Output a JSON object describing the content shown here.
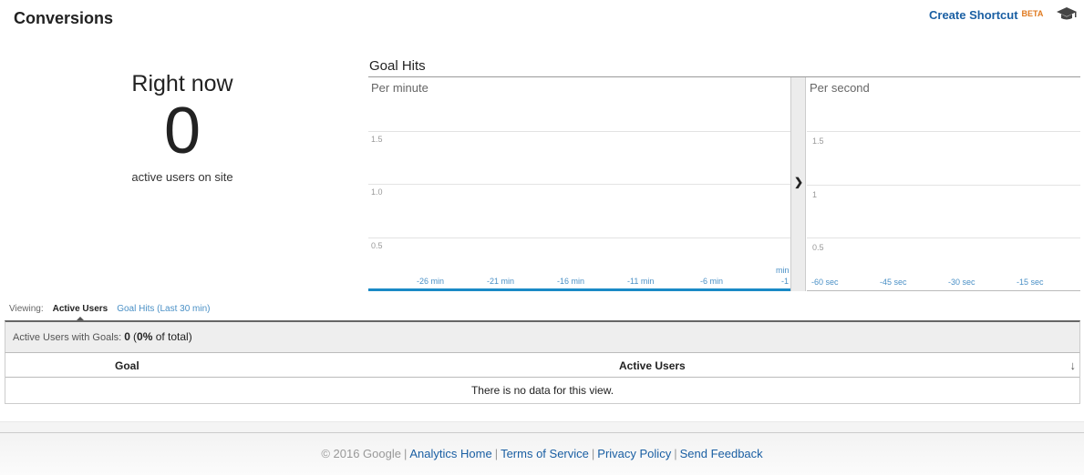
{
  "header": {
    "title": "Conversions",
    "create_shortcut": "Create Shortcut",
    "beta_badge": "BETA",
    "help_icon": "graduation-cap-icon"
  },
  "right_now": {
    "label": "Right now",
    "value": "0",
    "sublabel": "active users on site"
  },
  "goal_hits": {
    "title": "Goal Hits",
    "per_minute": {
      "label": "Per minute",
      "y_ticks": [
        "1.5",
        "1.0",
        "0.5"
      ],
      "x_ticks": [
        "-26 min",
        "-21 min",
        "-16 min",
        "-11 min",
        "-6 min"
      ],
      "last_tick_top": "min",
      "last_tick_bottom": "-1"
    },
    "per_second": {
      "label": "Per second",
      "y_ticks": [
        "1.5",
        "1",
        "0.5"
      ],
      "x_ticks": [
        "-60 sec",
        "-45 sec",
        "-30 sec",
        "-15 sec"
      ]
    },
    "expand_icon": "chevron-right-icon"
  },
  "chart_data": [
    {
      "type": "bar",
      "title": "Goal Hits - Per minute",
      "xlabel": "",
      "ylabel": "",
      "categories": [
        "-26 min",
        "-21 min",
        "-16 min",
        "-11 min",
        "-6 min",
        "-1 min"
      ],
      "values": [
        0,
        0,
        0,
        0,
        0,
        0
      ],
      "ylim": [
        0,
        2
      ],
      "y_ticks": [
        0.5,
        1.0,
        1.5
      ],
      "grid": true
    },
    {
      "type": "bar",
      "title": "Goal Hits - Per second",
      "xlabel": "",
      "ylabel": "",
      "categories": [
        "-60 sec",
        "-45 sec",
        "-30 sec",
        "-15 sec"
      ],
      "values": [
        0,
        0,
        0,
        0
      ],
      "ylim": [
        0,
        2
      ],
      "y_ticks": [
        0.5,
        1,
        1.5
      ],
      "grid": true
    }
  ],
  "viewing": {
    "label": "Viewing:",
    "tabs": [
      {
        "label": "Active Users",
        "active": true
      },
      {
        "label": "Goal Hits (Last 30 min)",
        "active": false
      }
    ]
  },
  "summary": {
    "label": "Active Users with Goals:",
    "value": "0",
    "pct_open": "(",
    "pct": "0%",
    "pct_rest": " of total)"
  },
  "table": {
    "columns": [
      "Goal",
      "Active Users"
    ],
    "sort_icon": "arrow-down-icon",
    "empty_message": "There is no data for this view."
  },
  "footer": {
    "copyright": "© 2016 Google",
    "links": [
      "Analytics Home",
      "Terms of Service",
      "Privacy Policy",
      "Send Feedback"
    ]
  }
}
